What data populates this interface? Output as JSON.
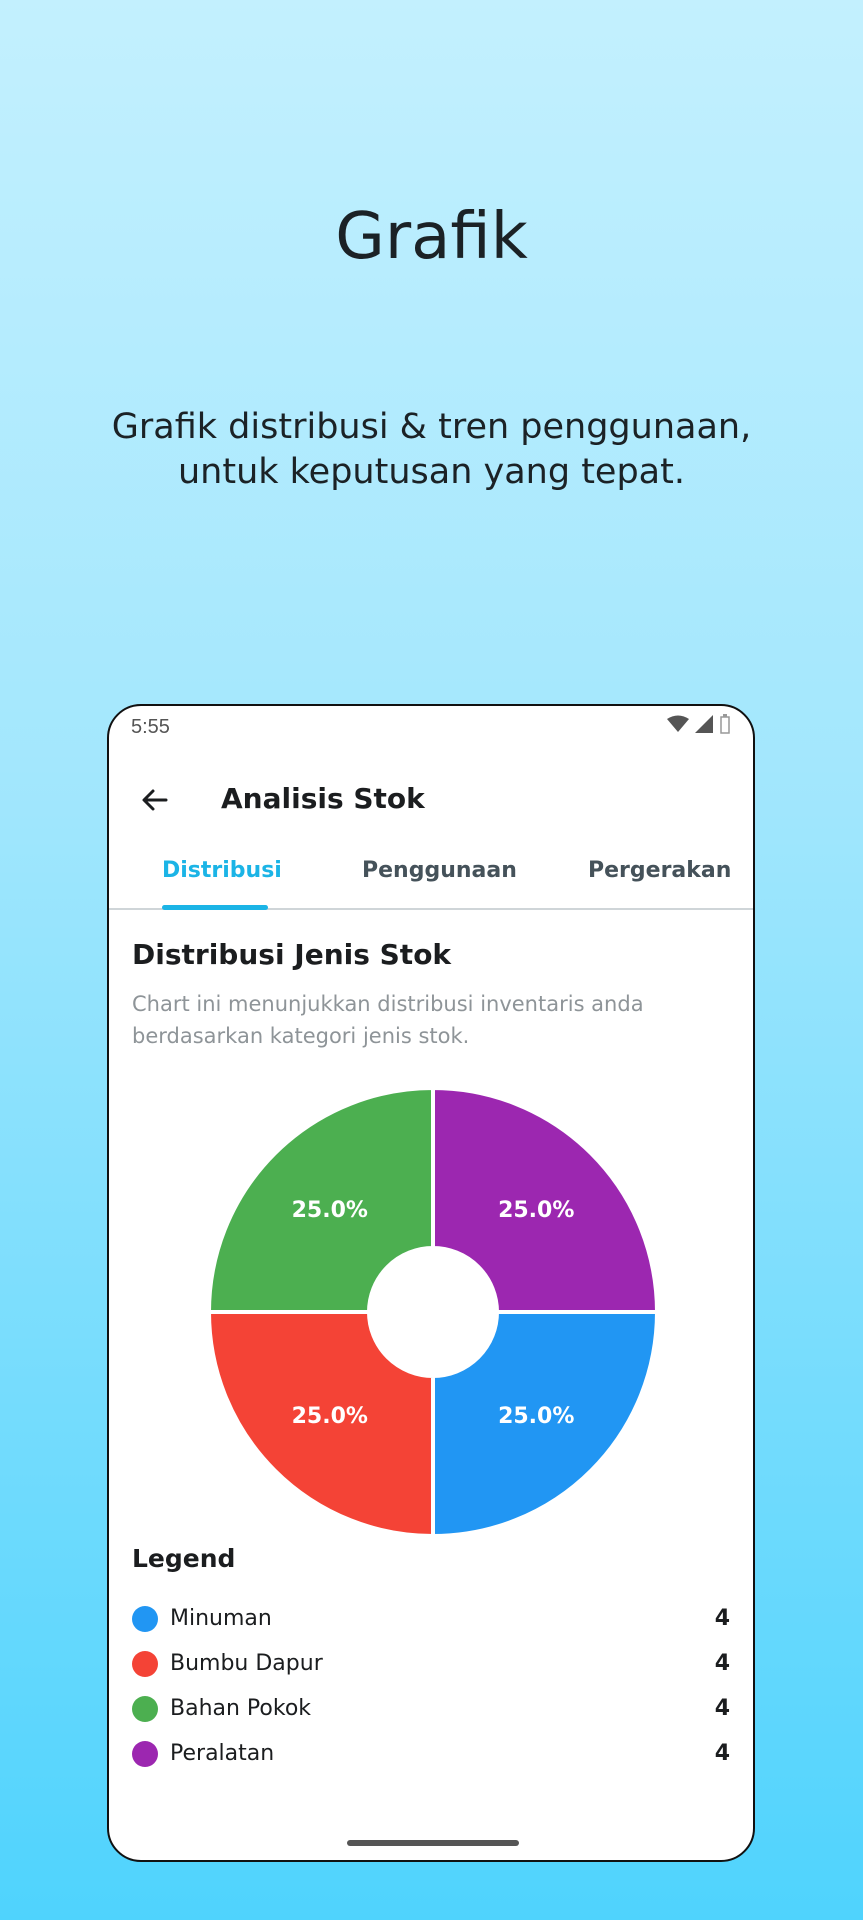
{
  "promo": {
    "title": "Grafik",
    "subtitle_line1": "Grafik distribusi & tren penggunaan,",
    "subtitle_line2": "untuk keputusan yang tepat."
  },
  "status_bar": {
    "time": "5:55"
  },
  "app_bar": {
    "title": "Analisis Stok"
  },
  "tabs": [
    {
      "label": "Distribusi",
      "active": true
    },
    {
      "label": "Penggunaan",
      "active": false
    },
    {
      "label": "Pergerakan",
      "active": false
    }
  ],
  "section": {
    "title": "Distribusi Jenis Stok",
    "description": "Chart ini menunjukkan distribusi inventaris anda berdasarkan kategori jenis stok."
  },
  "chart_data": {
    "type": "pie",
    "categories": [
      "Minuman",
      "Bumbu Dapur",
      "Bahan Pokok",
      "Peralatan"
    ],
    "values": [
      4,
      4,
      4,
      4
    ],
    "percent_labels": [
      "25.0%",
      "25.0%",
      "25.0%",
      "25.0%"
    ],
    "colors": [
      "#2196f3",
      "#f44336",
      "#4caf50",
      "#9c27b0"
    ],
    "donut": true
  },
  "legend": {
    "title": "Legend",
    "items": [
      {
        "label": "Minuman",
        "count": "4",
        "color": "#2196f3"
      },
      {
        "label": "Bumbu Dapur",
        "count": "4",
        "color": "#f44336"
      },
      {
        "label": "Bahan Pokok",
        "count": "4",
        "color": "#4caf50"
      },
      {
        "label": "Peralatan",
        "count": "4",
        "color": "#9c27b0"
      }
    ]
  },
  "colors": {
    "accent": "#1bb4e6"
  },
  "icons": {
    "back": "arrow-left-icon",
    "wifi": "wifi-icon",
    "signal": "signal-icon",
    "battery": "battery-icon"
  }
}
